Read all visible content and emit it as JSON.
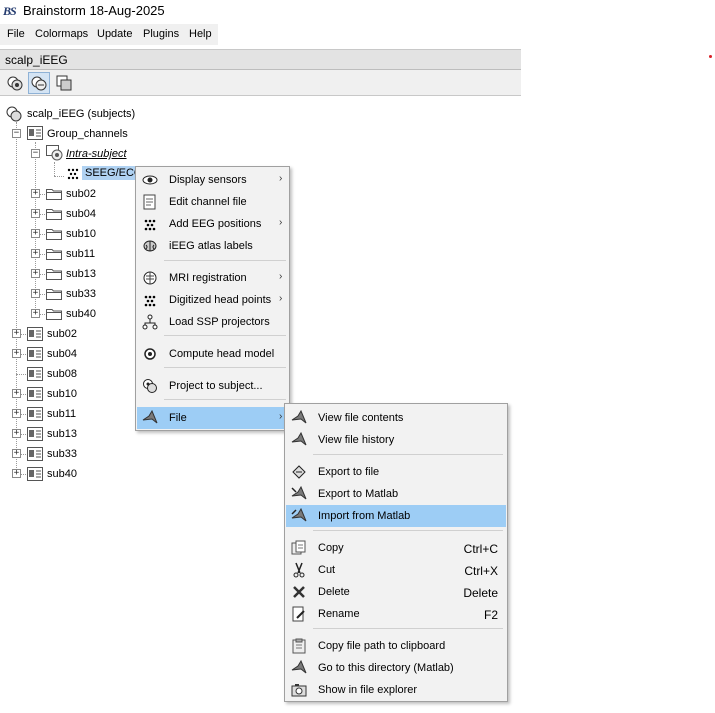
{
  "window": {
    "title": "Brainstorm 18-Aug-2025",
    "logo": "BS"
  },
  "menubar": {
    "items": [
      "File",
      "Colormaps",
      "Update",
      "Plugins",
      "Help"
    ]
  },
  "protocol": {
    "name": "scalp_iEEG"
  },
  "toolbar": {
    "buttons": [
      "view-anatomy-icon",
      "view-functional-icon",
      "view-studies-icon"
    ]
  },
  "tree": {
    "root": "scalp_iEEG (subjects)",
    "group": "Group_channels",
    "intra": "Intra-subject",
    "channel": "SEEG/ECO",
    "group_subjects": [
      "sub02",
      "sub04",
      "sub10",
      "sub11",
      "sub13",
      "sub33",
      "sub40"
    ],
    "subjects": [
      "sub02",
      "sub04",
      "sub08",
      "sub10",
      "sub11",
      "sub13",
      "sub33",
      "sub40"
    ]
  },
  "context_menu": {
    "items": [
      {
        "label": "Display sensors",
        "icon": "eye-icon",
        "submenu": true
      },
      {
        "label": "Edit channel file",
        "icon": "document-edit-icon",
        "submenu": false
      },
      {
        "label": "Add EEG positions",
        "icon": "dots-icon",
        "submenu": true
      },
      {
        "label": "iEEG atlas labels",
        "icon": "brain-icon",
        "submenu": false
      },
      {
        "label": "MRI registration",
        "icon": "head-icon",
        "submenu": true
      },
      {
        "label": "Digitized head points",
        "icon": "dots-icon",
        "submenu": true
      },
      {
        "label": "Load SSP projectors",
        "icon": "tree-icon",
        "submenu": false
      },
      {
        "label": "Compute head model",
        "icon": "head-model-icon",
        "submenu": false
      },
      {
        "label": "Project to subject...",
        "icon": "project-icon",
        "submenu": false
      },
      {
        "label": "File",
        "icon": "matlab-icon",
        "submenu": true
      }
    ]
  },
  "file_submenu": {
    "items": [
      {
        "label": "View file contents",
        "shortcut": "",
        "icon": "matlab-icon"
      },
      {
        "label": "View file history",
        "shortcut": "",
        "icon": "matlab-icon"
      },
      {
        "label": "Export to file",
        "shortcut": "",
        "icon": "export-file-icon"
      },
      {
        "label": "Export to Matlab",
        "shortcut": "",
        "icon": "matlab-export-icon"
      },
      {
        "label": "Import from Matlab",
        "shortcut": "",
        "icon": "matlab-import-icon"
      },
      {
        "label": "Copy",
        "shortcut": "Ctrl+C",
        "icon": "copy-icon"
      },
      {
        "label": "Cut",
        "shortcut": "Ctrl+X",
        "icon": "scissors-icon"
      },
      {
        "label": "Delete",
        "shortcut": "Delete",
        "icon": "delete-icon"
      },
      {
        "label": "Rename",
        "shortcut": "F2",
        "icon": "rename-icon"
      },
      {
        "label": "Copy file path to clipboard",
        "shortcut": "",
        "icon": "clipboard-icon"
      },
      {
        "label": "Go to this directory (Matlab)",
        "shortcut": "",
        "icon": "matlab-icon"
      },
      {
        "label": "Show in file explorer",
        "shortcut": "",
        "icon": "camera-icon"
      }
    ]
  },
  "colors": {
    "highlight": "#9dcdf5",
    "selection": "#b0d2f2",
    "menu_bg": "#f2f2f2"
  }
}
